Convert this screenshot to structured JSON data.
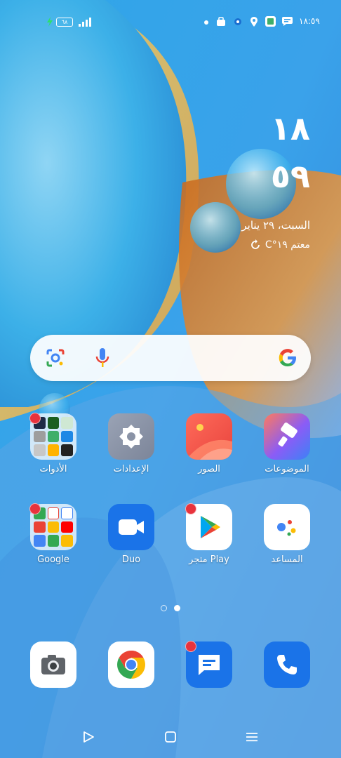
{
  "status_bar": {
    "time": "١٨:٥٩",
    "battery": "٦٨"
  },
  "clock": {
    "hour": "١٨",
    "minute": "٥٩",
    "date": "السبت، ٢٩ يناير",
    "weather": "معتم ١٩°C"
  },
  "apps": [
    {
      "label": "الموضوعات"
    },
    {
      "label": "الصور"
    },
    {
      "label": "الإعدادات"
    },
    {
      "label": "الأدوات"
    },
    {
      "label": "المساعد"
    },
    {
      "label": "متجر Play"
    },
    {
      "label": "Duo"
    },
    {
      "label": "Google"
    }
  ],
  "colors": {
    "notification_dot": "#e8333d",
    "dock_blue": "#1a73e8"
  },
  "icons": {
    "dock": [
      "phone-icon",
      "messages-icon",
      "chrome-icon",
      "camera-icon"
    ],
    "nav": [
      "recents-icon",
      "home-icon",
      "back-icon"
    ]
  }
}
